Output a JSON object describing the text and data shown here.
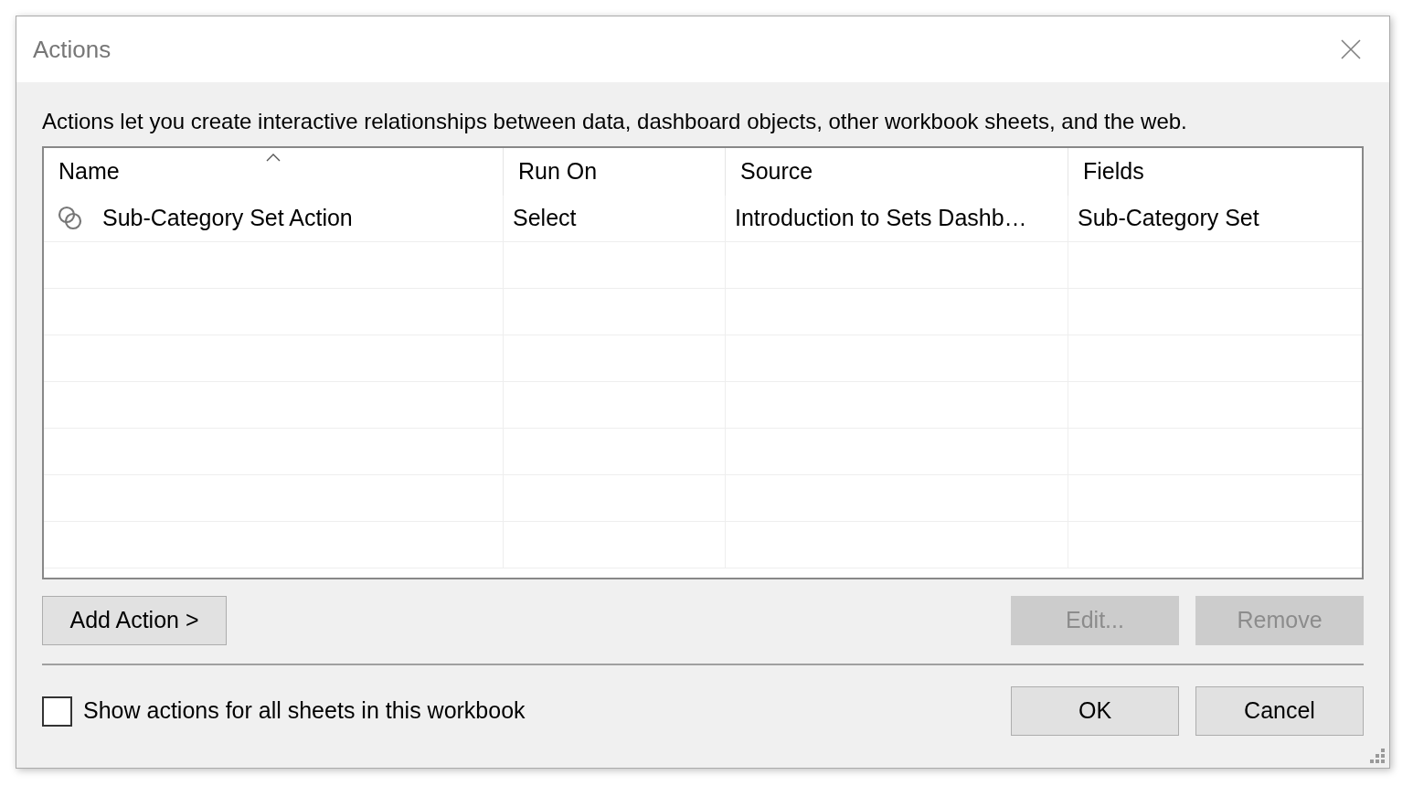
{
  "window": {
    "title": "Actions"
  },
  "description": "Actions let you create interactive relationships between data, dashboard objects, other workbook sheets, and the web.",
  "table": {
    "columns": [
      {
        "label": "Name",
        "sorted": true
      },
      {
        "label": "Run On",
        "sorted": false
      },
      {
        "label": "Source",
        "sorted": false
      },
      {
        "label": "Fields",
        "sorted": false
      }
    ],
    "rows": [
      {
        "cells": [
          "Sub-Category Set Action",
          "Select",
          "Introduction to Sets Dashb…",
          "Sub-Category Set"
        ],
        "selected": false
      }
    ]
  },
  "action_buttons": [
    {
      "label": "Add Action >",
      "disabled": false
    },
    {
      "label": "Edit...",
      "disabled": true
    },
    {
      "label": "Remove",
      "disabled": true
    }
  ],
  "show_all_checkbox": {
    "label": "Show actions for all sheets in this workbook",
    "checked": false
  },
  "dialog_buttons": [
    {
      "label": "OK",
      "disabled": false
    },
    {
      "label": "Cancel",
      "disabled": false
    }
  ]
}
